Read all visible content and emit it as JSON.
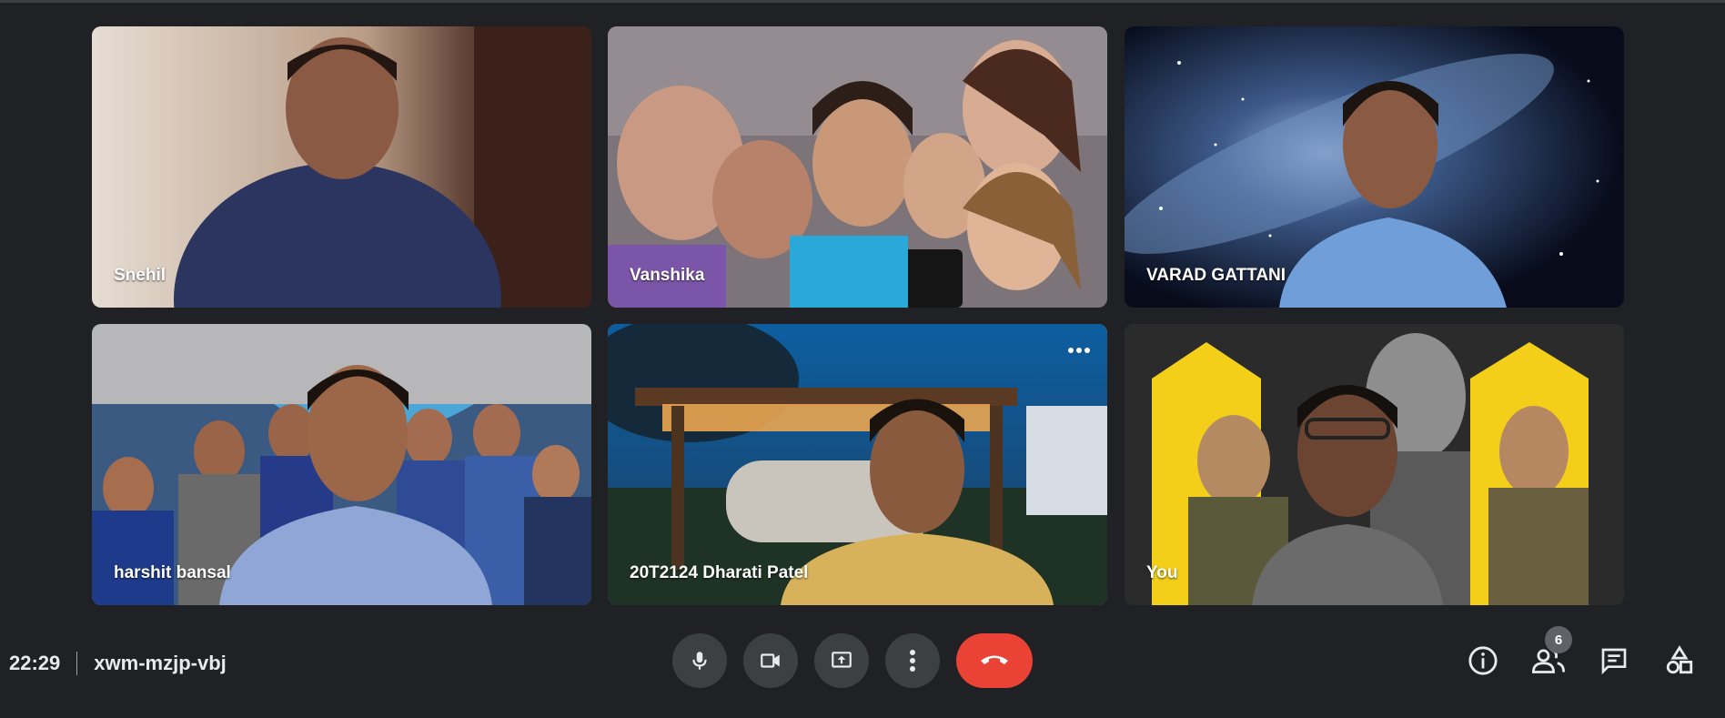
{
  "participants": [
    {
      "name": "Snehil"
    },
    {
      "name": "Vanshika"
    },
    {
      "name": "VARAD GATTANI"
    },
    {
      "name": "harshit bansal"
    },
    {
      "name": "20T2124 Dharati Patel"
    },
    {
      "name": "You"
    }
  ],
  "meeting": {
    "time": "22:29",
    "code": "xwm-mzjp-vbj"
  },
  "people_count": "6",
  "colors": {
    "background": "#202124",
    "control_bg": "#3c4043",
    "end_call": "#ea4335",
    "active_speaker": "#8ab4f8"
  },
  "icons": [
    "mic-icon",
    "camera-icon",
    "present-icon",
    "more-vert-icon",
    "end-call-icon",
    "info-icon",
    "people-icon",
    "chat-icon",
    "activities-icon"
  ]
}
